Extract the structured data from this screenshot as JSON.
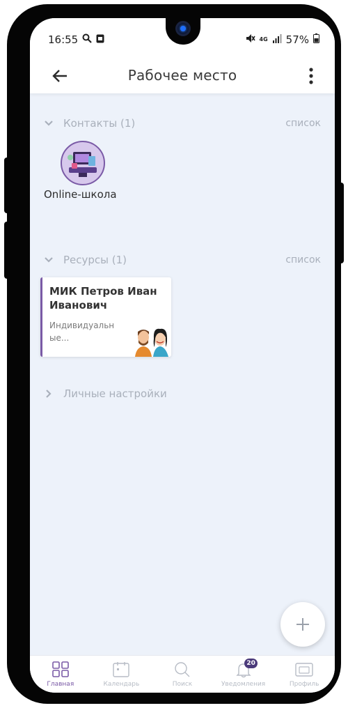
{
  "colors": {
    "accent": "#7a5aa6",
    "screen_bg": "#edf2fa",
    "muted_text": "#a9b0bb",
    "badge_bg": "#4b3a7a"
  },
  "status_bar": {
    "time": "16:55",
    "left_icons": [
      "search-icon",
      "notification-app-icon"
    ],
    "network_label": "4G",
    "battery": "57%",
    "right_icons": [
      "mute-icon",
      "signal-icon",
      "battery-icon"
    ]
  },
  "app_bar": {
    "title": "Рабочее место",
    "back_icon": "arrow-left-icon",
    "menu_icon": "more-vertical-icon"
  },
  "contacts": {
    "title": "Контакты (1)",
    "action": "список",
    "items": [
      {
        "name": "Online-школа",
        "avatar": "online-school-avatar"
      }
    ]
  },
  "resources": {
    "title": "Ресурсы (1)",
    "action": "список",
    "items": [
      {
        "title": "МИК Петров Иван Иванович",
        "description": "Индивидуальн ые...",
        "image": "people-illustration"
      }
    ]
  },
  "personal_settings": {
    "title": "Личные настройки"
  },
  "fab": {
    "icon": "plus-icon"
  },
  "bottom_nav": {
    "items": [
      {
        "label": "Главная",
        "icon": "grid-icon",
        "active": true
      },
      {
        "label": "Календарь",
        "icon": "calendar-icon",
        "active": false
      },
      {
        "label": "Поиск",
        "icon": "search-icon",
        "active": false
      },
      {
        "label": "Уведомления",
        "icon": "bell-icon",
        "active": false,
        "badge": "20"
      },
      {
        "label": "Профиль",
        "icon": "profile-card-icon",
        "active": false
      }
    ]
  }
}
